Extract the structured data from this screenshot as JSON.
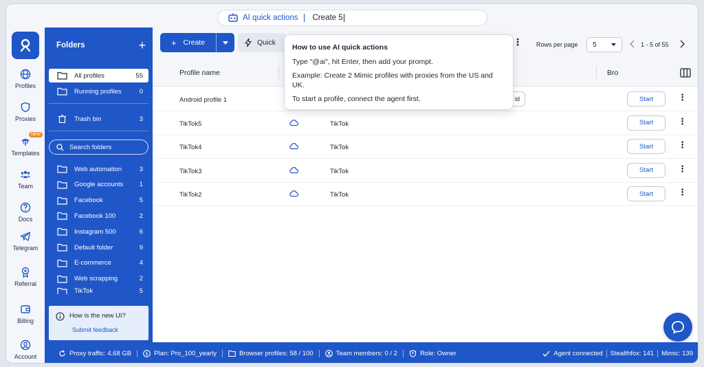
{
  "ai_bar": {
    "label": "AI quick actions",
    "input_value": "Create 5"
  },
  "rail": {
    "items": [
      {
        "label": "Profiles",
        "icon": "globe-icon"
      },
      {
        "label": "Proxies",
        "icon": "shield-icon"
      },
      {
        "label": "Templates",
        "icon": "templates-icon",
        "badge": "NEW"
      },
      {
        "label": "Team",
        "icon": "team-icon"
      },
      {
        "label": "Docs",
        "icon": "question-icon"
      },
      {
        "label": "Telegram",
        "icon": "telegram-icon"
      },
      {
        "label": "Referral",
        "icon": "referral-icon"
      },
      {
        "label": "Billing",
        "icon": "wallet-icon"
      },
      {
        "label": "Account",
        "icon": "account-icon"
      }
    ]
  },
  "folders": {
    "title": "Folders",
    "add_label": "+",
    "all_profiles": {
      "name": "All profiles",
      "count": "55"
    },
    "running_profiles": {
      "name": "Running profiles",
      "count": "0"
    },
    "trash": {
      "name": "Trash bin",
      "count": "3"
    },
    "search_placeholder": "Search folders",
    "list": [
      {
        "name": "Web automation",
        "count": "3"
      },
      {
        "name": "Google accounts",
        "count": "1"
      },
      {
        "name": "Facebook",
        "count": "5"
      },
      {
        "name": "Facebook 100",
        "count": "2"
      },
      {
        "name": "Instagram 500",
        "count": "6"
      },
      {
        "name": "Default folder",
        "count": "9"
      },
      {
        "name": "E-commerce",
        "count": "4"
      },
      {
        "name": "Web scrapping",
        "count": "2"
      },
      {
        "name": "TikTok",
        "count": "5"
      }
    ],
    "feedback": {
      "question": "How is the new UI?",
      "link": "Submit feedback"
    }
  },
  "toolbar": {
    "create_label": "Create",
    "quick_label": "Quick",
    "rows_label": "Rows per page",
    "rows_value": "5",
    "pager_text": "1 - 5 of 55"
  },
  "table": {
    "headers": {
      "profile_name": "Profile name",
      "browser": "Bro"
    },
    "rows": [
      {
        "name": "Android profile 1",
        "tag": "",
        "start": "Start",
        "partial": "id"
      },
      {
        "name": "TikTok5",
        "tag": "TikTok",
        "start": "Start"
      },
      {
        "name": "TikTok4",
        "tag": "TikTok",
        "start": "Start"
      },
      {
        "name": "TikTok3",
        "tag": "TikTok",
        "start": "Start"
      },
      {
        "name": "TikTok2",
        "tag": "TikTok",
        "start": "Start"
      }
    ]
  },
  "tooltip": {
    "title": "How to use AI quick actions",
    "line1": "Type \"@ai\", hit Enter, then add your prompt.",
    "line2": "Example: Create 2 Mimic profiles with proxies from the US and UK.",
    "line3": "To start a profile, connect the agent first."
  },
  "status": {
    "proxy_traffic": "Proxy traffic: 4.68 GB",
    "plan": "Plan: Pro_100_yearly",
    "browser_profiles": "Browser profiles: 58 / 100",
    "team_members": "Team members: 0 / 2",
    "role": "Role: Owner",
    "agent": "Agent connected",
    "stealthfox": "Stealthfox: 141",
    "mimic": "Mimic: 139"
  },
  "colors": {
    "brand": "#1f56c8",
    "accent_badge": "#f08a2c"
  }
}
